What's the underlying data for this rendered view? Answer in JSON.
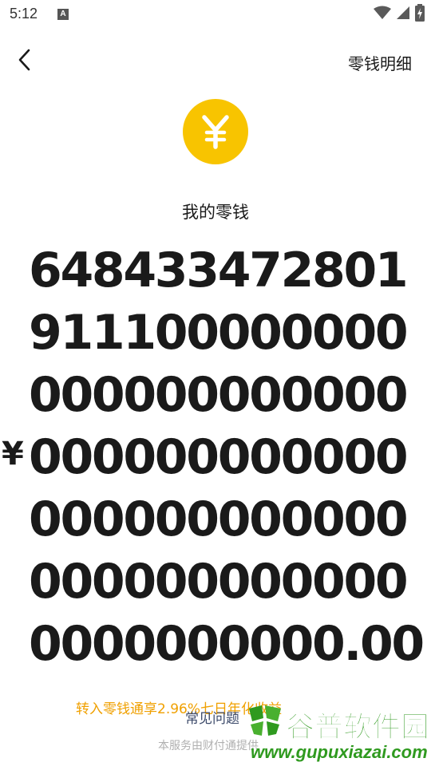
{
  "status_bar": {
    "time": "5:12",
    "notification_icon": "a-notification-icon",
    "icons": [
      "wifi-icon",
      "signal-icon",
      "battery-icon"
    ]
  },
  "header": {
    "back_icon": "chevron-left-icon",
    "detail_link": "零钱明细"
  },
  "wallet": {
    "coin_symbol": "¥",
    "coin_color": "#f8c400",
    "label": "我的零钱",
    "currency_symbol": "¥",
    "balance": "6484334728019111000000000000000000000000000000000000000000000000000000000000000000.00"
  },
  "footer": {
    "promo_text": "转入零钱通享2.96%七日年化收益",
    "promo_color": "#f0a000",
    "faq_text": "常见问题",
    "service_note": "本服务由财付通提供"
  },
  "watermark": {
    "title": "谷普软件园",
    "url": "www.gupuxiazai.com",
    "color": "#2f9a1f"
  }
}
